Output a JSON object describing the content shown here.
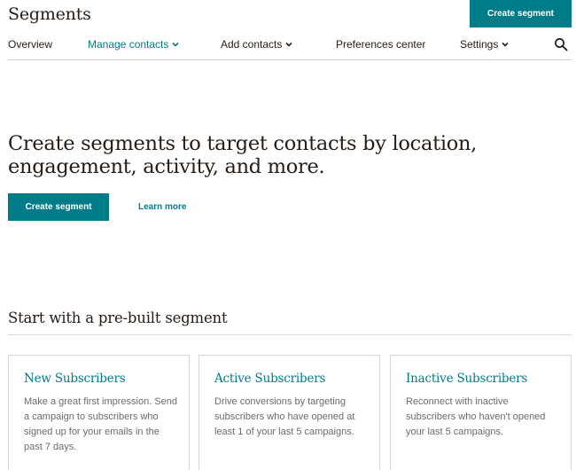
{
  "header": {
    "title": "Segments",
    "create_button": "Create segment"
  },
  "nav": {
    "items": [
      {
        "label": "Overview",
        "active": false,
        "has_dropdown": false
      },
      {
        "label": "Manage contacts",
        "active": true,
        "has_dropdown": true
      },
      {
        "label": "Add contacts",
        "active": false,
        "has_dropdown": true
      },
      {
        "label": "Preferences center",
        "active": false,
        "has_dropdown": false
      },
      {
        "label": "Settings",
        "active": false,
        "has_dropdown": true
      }
    ],
    "search_icon": "search-icon"
  },
  "hero": {
    "heading": "Create segments to target contacts by location, engagement, activity, and more.",
    "create_button": "Create segment",
    "learn_more": "Learn more"
  },
  "prebuilt": {
    "heading": "Start with a pre-built segment",
    "cards": [
      {
        "title": "New Subscribers",
        "description": "Make a great first impression. Send a campaign to subscribers who signed up for your emails in the past 7 days."
      },
      {
        "title": "Active Subscribers",
        "description": "Drive conversions by targeting subscribers who have opened at least 1 of your last 5 campaigns."
      },
      {
        "title": "Inactive Subscribers",
        "description": "Reconnect with inactive subscribers who haven't opened your last 5 campaigns."
      }
    ]
  },
  "colors": {
    "accent": "#007c89",
    "text": "#241c15",
    "muted": "#6b6b6b",
    "border": "#d6d6d6"
  }
}
